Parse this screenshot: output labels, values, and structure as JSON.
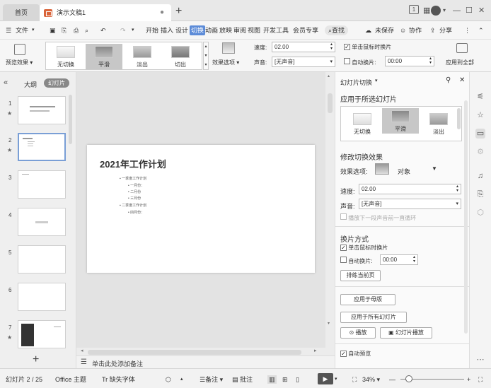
{
  "tabs": {
    "home": "首页",
    "doc": "演示文稿1",
    "add": "+"
  },
  "window": {
    "page_badge": "1",
    "minimize": "—",
    "maximize": "☐",
    "close": "✕"
  },
  "menu": {
    "file": "文件",
    "items": [
      "开始",
      "插入",
      "设计",
      "切换",
      "动画",
      "放映",
      "审阅",
      "视图",
      "开发工具",
      "会员专享"
    ],
    "active": "切换",
    "search": "查找",
    "unsaved": "未保存",
    "collab": "协作",
    "share": "分享"
  },
  "ribbon": {
    "preview": "预览效果",
    "gallery": [
      "无切换",
      "平滑",
      "淡出",
      "切出"
    ],
    "gallery_selected": "平滑",
    "effect_options": "效果选项",
    "speed_label": "速度:",
    "speed_value": "02.00",
    "sound_label": "声音:",
    "sound_value": "[无声音]",
    "on_click": "单击鼠标时换片",
    "auto_label": "自动换片:",
    "auto_value": "00:00",
    "apply_all": "应用到全部"
  },
  "leftpanel": {
    "outline": "大纲",
    "slides": "幻灯片",
    "numbers": [
      "1",
      "2",
      "3",
      "4",
      "5",
      "6",
      "7"
    ],
    "add": "+"
  },
  "slide": {
    "title": "2021年工作计划",
    "bullets": [
      "一季度工作计划",
      "一月份：",
      "二月份",
      "三月份",
      "二季度工作计划",
      "四月份："
    ]
  },
  "rightpane": {
    "title": "幻灯片切换",
    "apply_selected": "应用于所选幻灯片",
    "gallery": [
      "无切换",
      "平滑",
      "淡出"
    ],
    "modify_effect": "修改切换效果",
    "effect_options_label": "效果选项:",
    "effect_value": "对象",
    "speed_label": "速度:",
    "speed_value": "02.00",
    "sound_label": "声音:",
    "sound_value": "[无声音]",
    "loop_sound": "播放下一段声音前一直循环",
    "advance_title": "换片方式",
    "on_click": "单击鼠标时换片",
    "auto_label": "自动换片:",
    "auto_value": "00:00",
    "rehearse": "排练当前页",
    "apply_master": "应用于母版",
    "apply_all": "应用于所有幻灯片",
    "play": "播放",
    "slideshow": "幻灯片播放",
    "auto_preview": "自动预览"
  },
  "notes": {
    "placeholder": "单击此处添加备注"
  },
  "status": {
    "slide_counter": "幻灯片 2 / 25",
    "theme": "Office 主题",
    "missing_font": "缺失字体",
    "notes": "备注",
    "comments": "批注",
    "zoom": "34%"
  },
  "colors": {
    "accent": "#5d8cd8",
    "selected_thumb": "#7a9fd6"
  }
}
